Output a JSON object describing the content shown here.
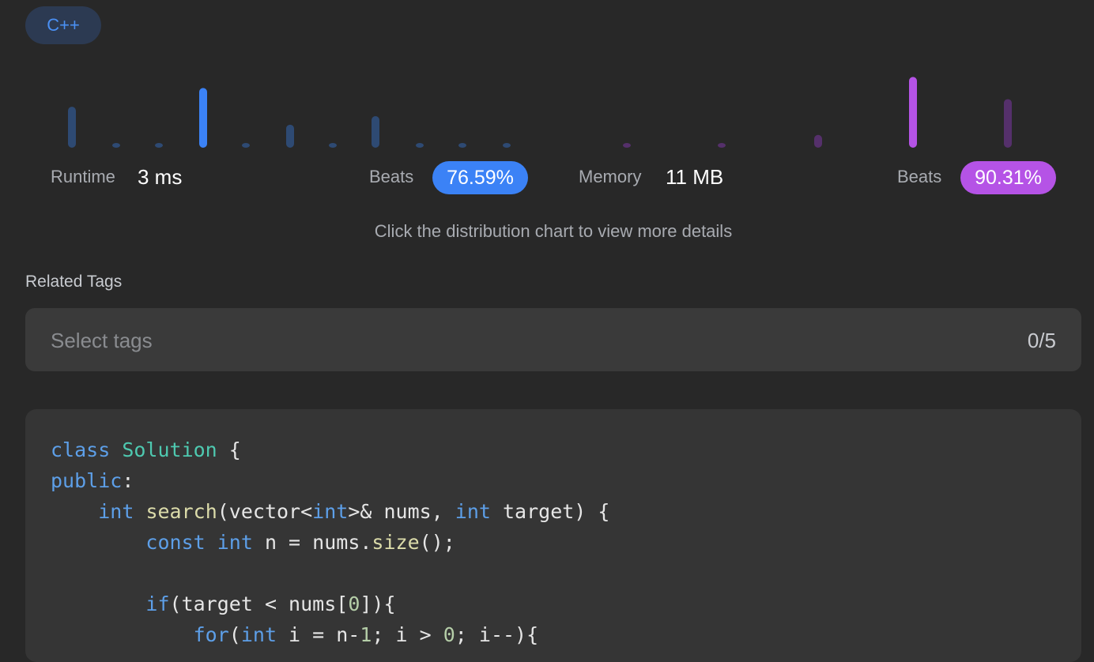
{
  "language": "C++",
  "stats": {
    "runtime_label": "Runtime",
    "runtime_value": "3 ms",
    "runtime_beats_label": "Beats",
    "runtime_beats": "76.59%",
    "memory_label": "Memory",
    "memory_value": "11 MB",
    "memory_beats_label": "Beats",
    "memory_beats": "90.31%"
  },
  "hint": "Click the distribution chart to view more details",
  "tags": {
    "title": "Related Tags",
    "placeholder": "Select tags",
    "count": "0/5"
  },
  "code_lines": [
    [
      [
        "kw",
        "class"
      ],
      [
        "t",
        " "
      ],
      [
        "cls",
        "Solution"
      ],
      [
        "t",
        " {"
      ]
    ],
    [
      [
        "kw",
        "public"
      ],
      [
        "t",
        ":"
      ]
    ],
    [
      [
        "t",
        "    "
      ],
      [
        "kw",
        "int"
      ],
      [
        "t",
        " "
      ],
      [
        "fn",
        "search"
      ],
      [
        "t",
        "(vector<"
      ],
      [
        "kw",
        "int"
      ],
      [
        "t",
        ">& nums, "
      ],
      [
        "kw",
        "int"
      ],
      [
        "t",
        " target) {"
      ]
    ],
    [
      [
        "t",
        "        "
      ],
      [
        "kw",
        "const"
      ],
      [
        "t",
        " "
      ],
      [
        "kw",
        "int"
      ],
      [
        "t",
        " n = nums."
      ],
      [
        "fn",
        "size"
      ],
      [
        "t",
        "();"
      ]
    ],
    [],
    [
      [
        "t",
        "        "
      ],
      [
        "kw",
        "if"
      ],
      [
        "t",
        "(target < nums["
      ],
      [
        "num",
        "0"
      ],
      [
        "t",
        "]){"
      ]
    ],
    [
      [
        "t",
        "            "
      ],
      [
        "kw",
        "for"
      ],
      [
        "t",
        "("
      ],
      [
        "kw",
        "int"
      ],
      [
        "t",
        " i = n-"
      ],
      [
        "num",
        "1"
      ],
      [
        "t",
        "; i > "
      ],
      [
        "num",
        "0"
      ],
      [
        "t",
        "; i--){"
      ]
    ]
  ],
  "chart_data": {
    "type": "bar",
    "series": [
      {
        "values": [
          0.48,
          0.04,
          0.04,
          0.7,
          0.04,
          0.27,
          0.04,
          0.37,
          0.04,
          0.04,
          0.04
        ],
        "highlight_index": 3,
        "color": "#3b82f6",
        "dim_color": "#2e4a73"
      },
      {
        "values": [
          0.04,
          0.04,
          0.15,
          0.83,
          0.57
        ],
        "highlight_index": 3,
        "color": "#b553e6",
        "dim_color": "#55306b"
      }
    ]
  },
  "colors": {
    "background": "#282828",
    "runtime_accent": "#3b82f6",
    "memory_accent": "#b553e6"
  }
}
